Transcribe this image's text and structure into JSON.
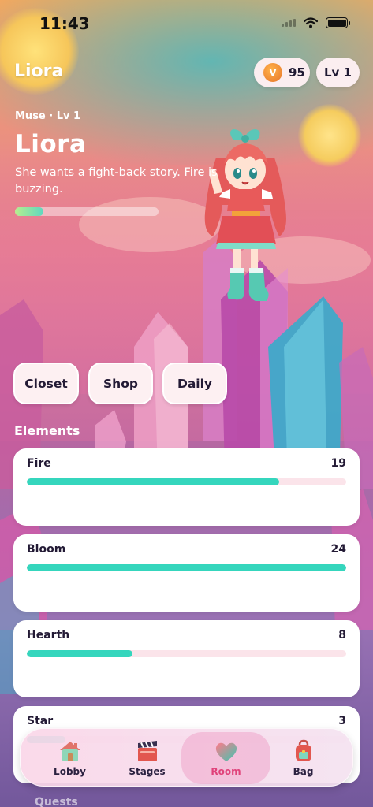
{
  "status_bar": {
    "time": "11:43"
  },
  "header": {
    "title": "Liora",
    "coins": "95",
    "level": "Lv 1"
  },
  "character": {
    "subtitle": "Muse · Lv 1",
    "name": "Liora",
    "description": "She wants a fight-back story. Fire is buzzing.",
    "xp_progress": 0.2
  },
  "actions": {
    "closet": "Closet",
    "shop": "Shop",
    "daily": "Daily"
  },
  "elements": {
    "title": "Elements",
    "items": [
      {
        "label": "Fire",
        "value": "19",
        "progress": 0.79
      },
      {
        "label": "Bloom",
        "value": "24",
        "progress": 1.0
      },
      {
        "label": "Hearth",
        "value": "8",
        "progress": 0.33
      },
      {
        "label": "Star",
        "value": "3",
        "progress": 0.12
      }
    ]
  },
  "next_section": "Quests",
  "tabs": [
    {
      "label": "Lobby",
      "icon": "house-icon"
    },
    {
      "label": "Stages",
      "icon": "clapperboard-icon"
    },
    {
      "label": "Room",
      "icon": "heart-icon",
      "active": true
    },
    {
      "label": "Bag",
      "icon": "backpack-icon"
    }
  ],
  "colors": {
    "accent": "#35d6bd",
    "active_tab": "#e0427a",
    "coin": "#e7762a"
  }
}
